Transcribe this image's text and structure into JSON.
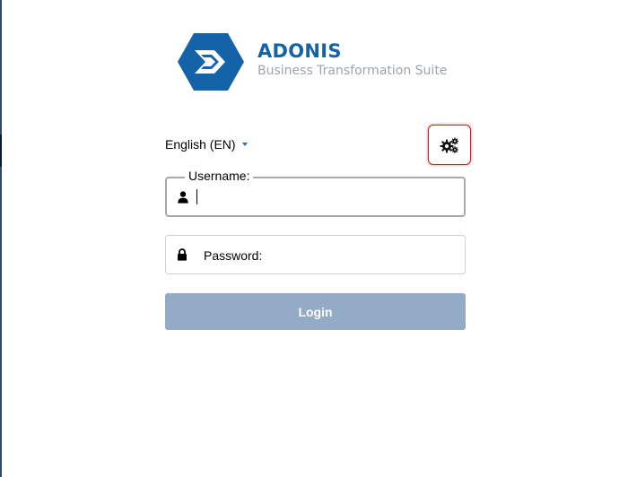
{
  "brand": {
    "title": "ADONIS",
    "subtitle": "Business Transformation Suite",
    "logo_icon": "adonis-hexagon-logo",
    "primary_color": "#1462a8"
  },
  "language": {
    "selected": "English (EN)"
  },
  "settings": {
    "icon": "gears-icon",
    "highlight_color": "#e0161b"
  },
  "username": {
    "label": "Username:",
    "value": "",
    "icon": "user-icon"
  },
  "password": {
    "placeholder": "Password:",
    "value": "",
    "icon": "lock-icon"
  },
  "login": {
    "label": "Login",
    "color": "#93abc6"
  }
}
